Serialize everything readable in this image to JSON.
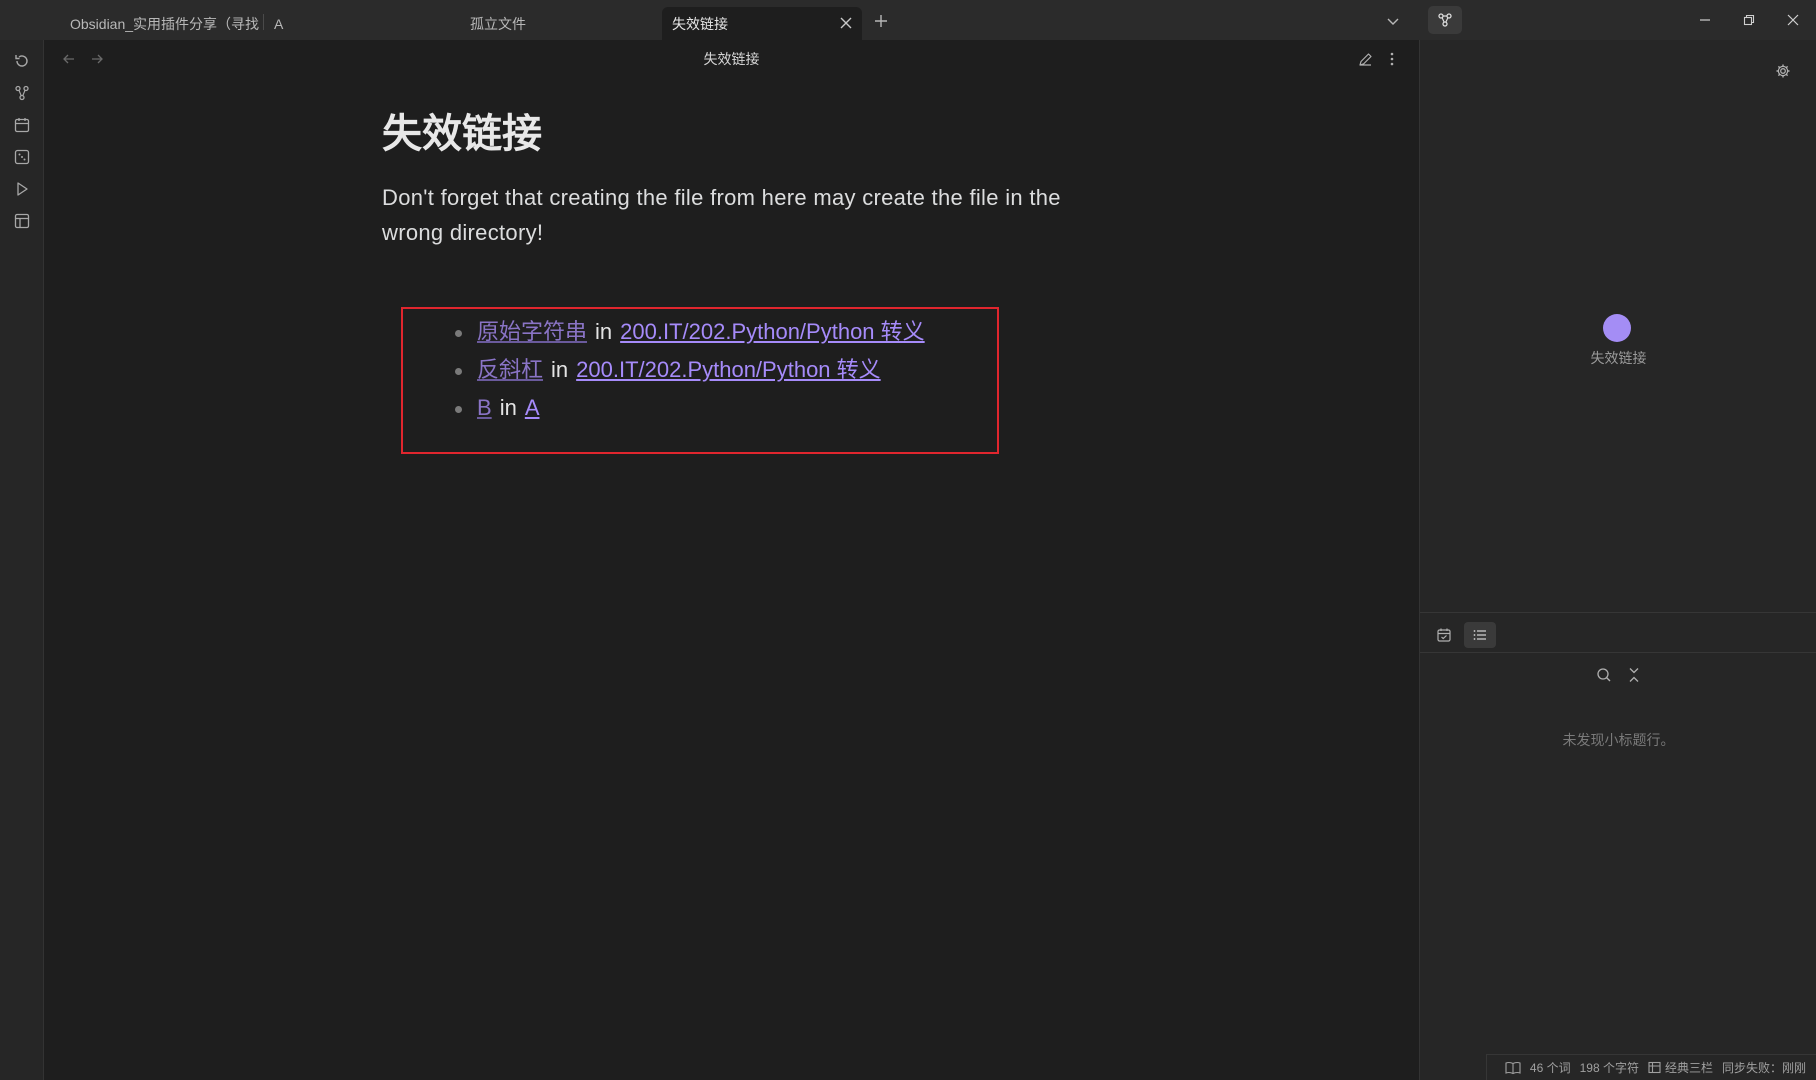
{
  "tabs": [
    {
      "label": "Obsidian_实用插件分享（寻找..."
    },
    {
      "label": "A"
    },
    {
      "label": "孤立文件"
    },
    {
      "label": "失效链接"
    }
  ],
  "active_tab": "失效链接",
  "view": {
    "title": "失效链接"
  },
  "document": {
    "title": "失效链接",
    "paragraph": "Don't forget that creating the file from here may create the file in the wrong directory!",
    "links": [
      {
        "link": "原始字符串",
        "in": "in",
        "source": "200.IT/202.Python/Python 转义"
      },
      {
        "link": "反斜杠",
        "in": "in",
        "source": "200.IT/202.Python/Python 转义"
      },
      {
        "link": "B",
        "in": "in",
        "source": "A"
      }
    ]
  },
  "graph": {
    "node_label": "失效链接",
    "node_color": "#a48df5"
  },
  "outline": {
    "empty_message": "未发现小标题行。"
  },
  "status": {
    "words": "46 个词",
    "chars": "198 个字符",
    "layout": "经典三栏",
    "sync": "同步失败：刚刚"
  },
  "colors": {
    "accent": "#a68bfa",
    "unresolved_link": "#8a74c6",
    "highlight_border": "#e0262e",
    "background": "#1e1e1e"
  },
  "icons": {
    "ribbon": [
      "sync-icon",
      "graph-icon",
      "calendar-icon",
      "random-note-icon",
      "run-icon",
      "template-icon"
    ]
  }
}
